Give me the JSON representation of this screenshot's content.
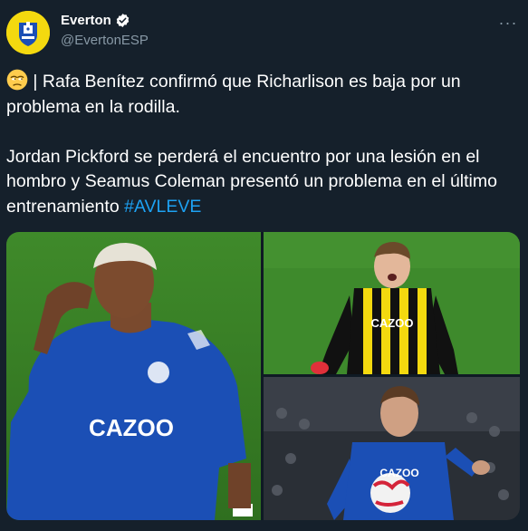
{
  "account": {
    "display_name": "Everton",
    "handle": "@EvertonESP",
    "verified": true,
    "avatar_icon": "everton-crest-icon",
    "avatar_bg": "#f4d90f"
  },
  "tweet": {
    "line1": " | Rafa Benítez confirmó que Richarlison es baja por un problema en la rodilla.",
    "line2_text": "Jordan Pickford se perderá el encuentro por una lesión en el hombro y Seamus Coleman presentó un problema en el último entrenamiento ",
    "hashtag": "#AVLEVE",
    "emoji": "unamused-face-icon"
  },
  "media": {
    "photos": [
      {
        "alt": "Richarlison",
        "jersey_text": "CAZOO"
      },
      {
        "alt": "Jordan Pickford",
        "jersey_text": "CAZOO"
      },
      {
        "alt": "Seamus Coleman",
        "jersey_text": "CAZOO"
      }
    ]
  },
  "colors": {
    "background": "#15202b",
    "accent": "#1da1f2",
    "secondary_text": "#8899a6",
    "everton_blue": "#1b4fb5"
  }
}
